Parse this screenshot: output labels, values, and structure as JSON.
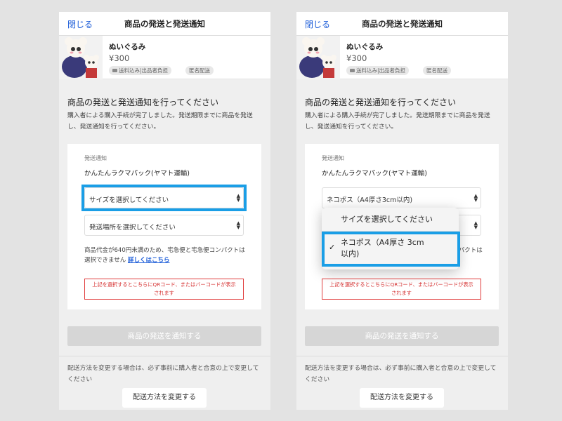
{
  "screen": {
    "close_label": "閉じる",
    "title": "商品の発送と発送通知"
  },
  "item": {
    "name": "ぬいぐるみ",
    "price": "¥300",
    "tags": [
      "送料込み|出品者負担",
      "匿名配送"
    ]
  },
  "main": {
    "heading": "商品の発送と発送通知を行ってください",
    "description": "購入者による購入手続が完了しました。発送期限までに商品を発送し、発送通知を行ってください。"
  },
  "card": {
    "label": "発送通知",
    "service": "かんたんラクマパック(ヤマト運輸)",
    "size_select_placeholder": "サイズを選択してください",
    "size_select_selected": "ネコポス（A4厚さ3cm以内)",
    "location_select_placeholder": "発送場所を選択してください",
    "note": "商品代金が640円未満のため、宅急便と宅急便コンパクトは選択できません",
    "note_link": "詳しくはこちら",
    "warning_line1": "上記を選択するとこちらにQRコード、またはバーコードが表示",
    "warning_line2": "されます"
  },
  "notify_button": "商品の発送を通知する",
  "footer": {
    "change_note": "配送方法を変更する場合は、必ず事前に購入者と合意の上で変更してください",
    "change_button": "配送方法を変更する"
  },
  "dropdown": {
    "options": [
      "サイズを選択してください",
      "ネコポス（A4厚さ3cm以内)"
    ],
    "selected_line1": "ネコポス（A4厚さ 3cm",
    "selected_line2": "以内)"
  },
  "colors": {
    "highlight": "#1a9ee6",
    "link": "#1a5bd8",
    "warning": "#d63333"
  }
}
